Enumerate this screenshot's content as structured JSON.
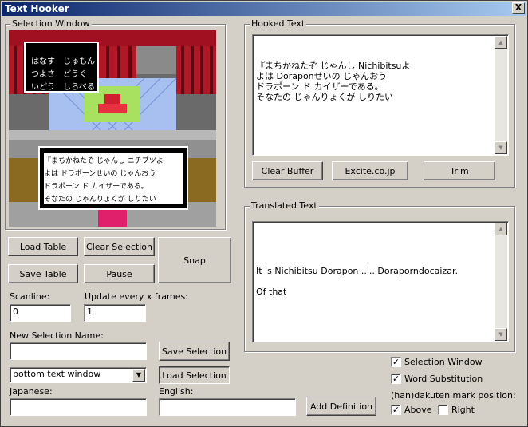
{
  "window": {
    "title": "Text Hooker",
    "close_glyph": "X"
  },
  "selection_window": {
    "legend": "Selection Window",
    "game_menu": [
      "はなす",
      "じゅもん",
      "つよさ",
      "どうぐ",
      "いどう",
      "しらべる"
    ],
    "game_dialog": [
      "『まちかねたぞ じゃんし ニチブツよ",
      "よは ドラポーンせいの じゃんおう",
      "ドラポーン ド カイザーである。",
      "そなたの じゃんりょくが しりたい"
    ]
  },
  "hooked": {
    "legend": "Hooked Text",
    "text": "『まちかねたぞ じゃんし Nichibitsuよ\nよは Doraponせいの じゃんおう\nドラポーン ド カイザーである。\nそなたの じゃんりょくが しりたい",
    "clear_buffer": "Clear Buffer",
    "excite": "Excite.co.jp",
    "trim": "Trim"
  },
  "translated": {
    "legend": "Translated Text",
    "text": "It is Nichibitsu Dorapon ..'.. Doraporndocaizar.\n\nOf that"
  },
  "buttons": {
    "load_table": "Load Table",
    "clear_selection": "Clear Selection",
    "snap": "Snap",
    "save_table": "Save Table",
    "pause": "Pause",
    "save_selection": "Save Selection",
    "load_selection": "Load Selection",
    "add_definition": "Add Definition"
  },
  "fields": {
    "scanline_label": "Scanline:",
    "scanline_value": "0",
    "update_label": "Update every x frames:",
    "update_value": "1",
    "new_selection_label": "New Selection Name:",
    "new_selection_value": "",
    "selection_dropdown": "bottom text window",
    "japanese_label": "Japanese:",
    "japanese_value": "",
    "english_label": "English:",
    "english_value": ""
  },
  "options": {
    "selection_window": "Selection Window",
    "word_substitution": "Word Substitution",
    "dakuten_label": "(han)dakuten mark position:",
    "above": "Above",
    "right": "Right",
    "check_glyph": "✓"
  }
}
